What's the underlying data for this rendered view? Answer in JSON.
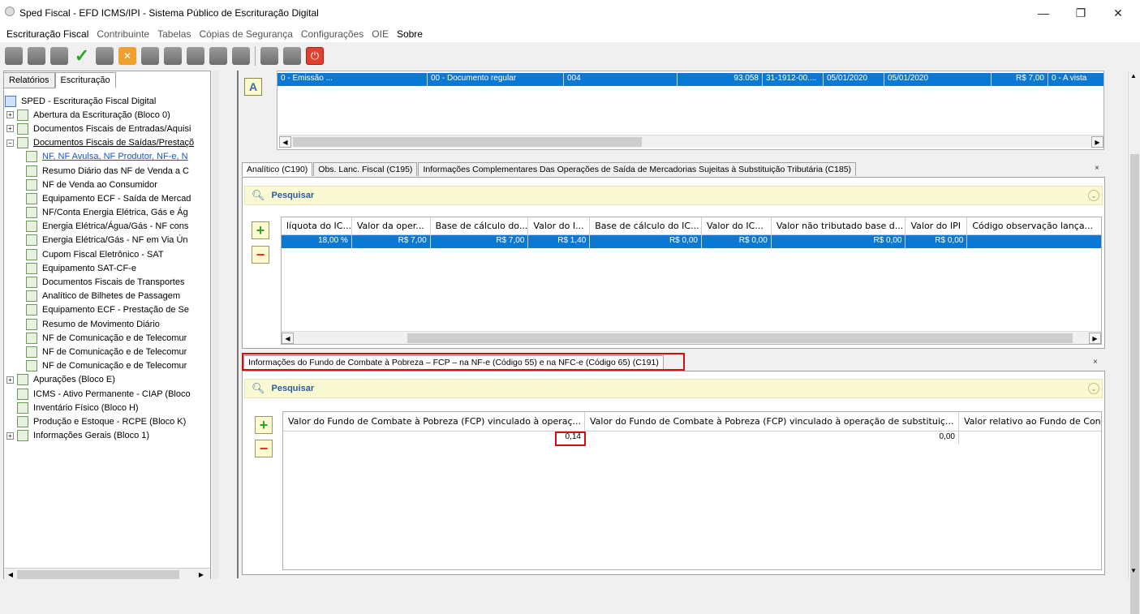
{
  "window": {
    "title": "Sped Fiscal - EFD ICMS/IPI - Sistema Público de Escrituração Digital",
    "min": "—",
    "max": "❐",
    "close": "✕"
  },
  "menu": [
    "Escrituração Fiscal",
    "Contribuinte",
    "Tabelas",
    "Cópias de Segurança",
    "Configurações",
    "OIE",
    "Sobre"
  ],
  "left": {
    "tabs": [
      "Relatórios",
      "Escrituração"
    ],
    "tree": [
      {
        "label": "SPED - Escrituração Fiscal Digital",
        "level": 0,
        "exp": "",
        "icon": "blue"
      },
      {
        "label": "Abertura da Escrituração (Bloco 0)",
        "level": 1,
        "exp": "+"
      },
      {
        "label": "Documentos Fiscais de Entradas/Aquisi",
        "level": 1,
        "exp": "+"
      },
      {
        "label": "Documentos Fiscais de Saídas/Prestaçõ",
        "level": 1,
        "exp": "−",
        "underline": true
      },
      {
        "label": "NF, NF Avulsa, NF Produtor, NF-e, N",
        "level": 2,
        "exp": "",
        "link": true
      },
      {
        "label": "Resumo Diário das NF de Venda a C",
        "level": 2,
        "exp": ""
      },
      {
        "label": "NF de Venda ao Consumidor",
        "level": 2,
        "exp": ""
      },
      {
        "label": "Equipamento ECF - Saída de Mercad",
        "level": 2,
        "exp": ""
      },
      {
        "label": "NF/Conta Energia Elétrica, Gás e Ág",
        "level": 2,
        "exp": ""
      },
      {
        "label": "Energia Elétrica/Água/Gás - NF cons",
        "level": 2,
        "exp": ""
      },
      {
        "label": "Energia Elétrica/Gás - NF em Via Ún",
        "level": 2,
        "exp": ""
      },
      {
        "label": "Cupom Fiscal Eletrônico - SAT",
        "level": 2,
        "exp": ""
      },
      {
        "label": "Equipamento SAT-CF-e",
        "level": 2,
        "exp": ""
      },
      {
        "label": "Documentos Fiscais de Transportes",
        "level": 2,
        "exp": ""
      },
      {
        "label": "Analítico de Bilhetes de Passagem",
        "level": 2,
        "exp": ""
      },
      {
        "label": "Equipamento ECF - Prestação de Se",
        "level": 2,
        "exp": ""
      },
      {
        "label": "Resumo de Movimento Diário",
        "level": 2,
        "exp": ""
      },
      {
        "label": "NF de Comunicação e de Telecomur",
        "level": 2,
        "exp": ""
      },
      {
        "label": "NF de Comunicação e de Telecomur",
        "level": 2,
        "exp": ""
      },
      {
        "label": "NF de Comunicação e de Telecomur",
        "level": 2,
        "exp": ""
      },
      {
        "label": "Apurações (Bloco E)",
        "level": 1,
        "exp": "+"
      },
      {
        "label": "ICMS - Ativo Permanente - CIAP (Bloco",
        "level": 1,
        "exp": ""
      },
      {
        "label": "Inventário Físico (Bloco H)",
        "level": 1,
        "exp": ""
      },
      {
        "label": "Produção e Estoque - RCPE (Bloco K)",
        "level": 1,
        "exp": ""
      },
      {
        "label": "Informações Gerais (Bloco 1)",
        "level": 1,
        "exp": "+"
      }
    ]
  },
  "top_grid": {
    "a_button": "A",
    "row": {
      "c1": "0 - Emissão ...",
      "c2": "00 - Documento regular",
      "c3": "004",
      "c4": "93.058",
      "c5": "31-1912-00....",
      "c6": "05/01/2020",
      "c7": "05/01/2020",
      "c8": "R$ 7,00",
      "c9": "0 - A vista"
    }
  },
  "analitico": {
    "tabs": [
      "Analítico (C190)",
      "Obs. Lanc. Fiscal (C195)",
      "Informações Complementares Das Operações de Saída de Mercadorias Sujeitas à Substituição Tributária (C185)"
    ],
    "close": "×",
    "search_label": "Pesquisar",
    "columns": [
      "líquota do IC...",
      "Valor da oper...",
      "Base de cálculo do...",
      "Valor do I...",
      "Base de cálculo do IC...",
      "Valor do IC...",
      "Valor não tributado base d...",
      "Valor do IPI",
      "Código observação lança..."
    ],
    "row": [
      "18,00 %",
      "R$ 7,00",
      "R$ 7,00",
      "R$ 1,40",
      "R$ 0,00",
      "R$ 0,00",
      "R$ 0,00",
      "R$ 0,00",
      ""
    ]
  },
  "fcp": {
    "tab": "Informações do Fundo de Combate à Pobreza – FCP – na NF-e (Código 55) e na NFC-e (Código 65) (C191)",
    "close": "×",
    "search_label": "Pesquisar",
    "columns": [
      "Valor do Fundo de Combate à Pobreza (FCP) vinculado à operaç...",
      "Valor do Fundo de Combate à Pobreza (FCP) vinculado à operação de substituiç...",
      "Valor relativo ao Fundo de Con"
    ],
    "row": [
      "0,14",
      "0,00",
      ""
    ]
  },
  "colors": {
    "selection": "#0a78d6",
    "highlight": "#d01010",
    "search_bg": "#fafad2"
  }
}
